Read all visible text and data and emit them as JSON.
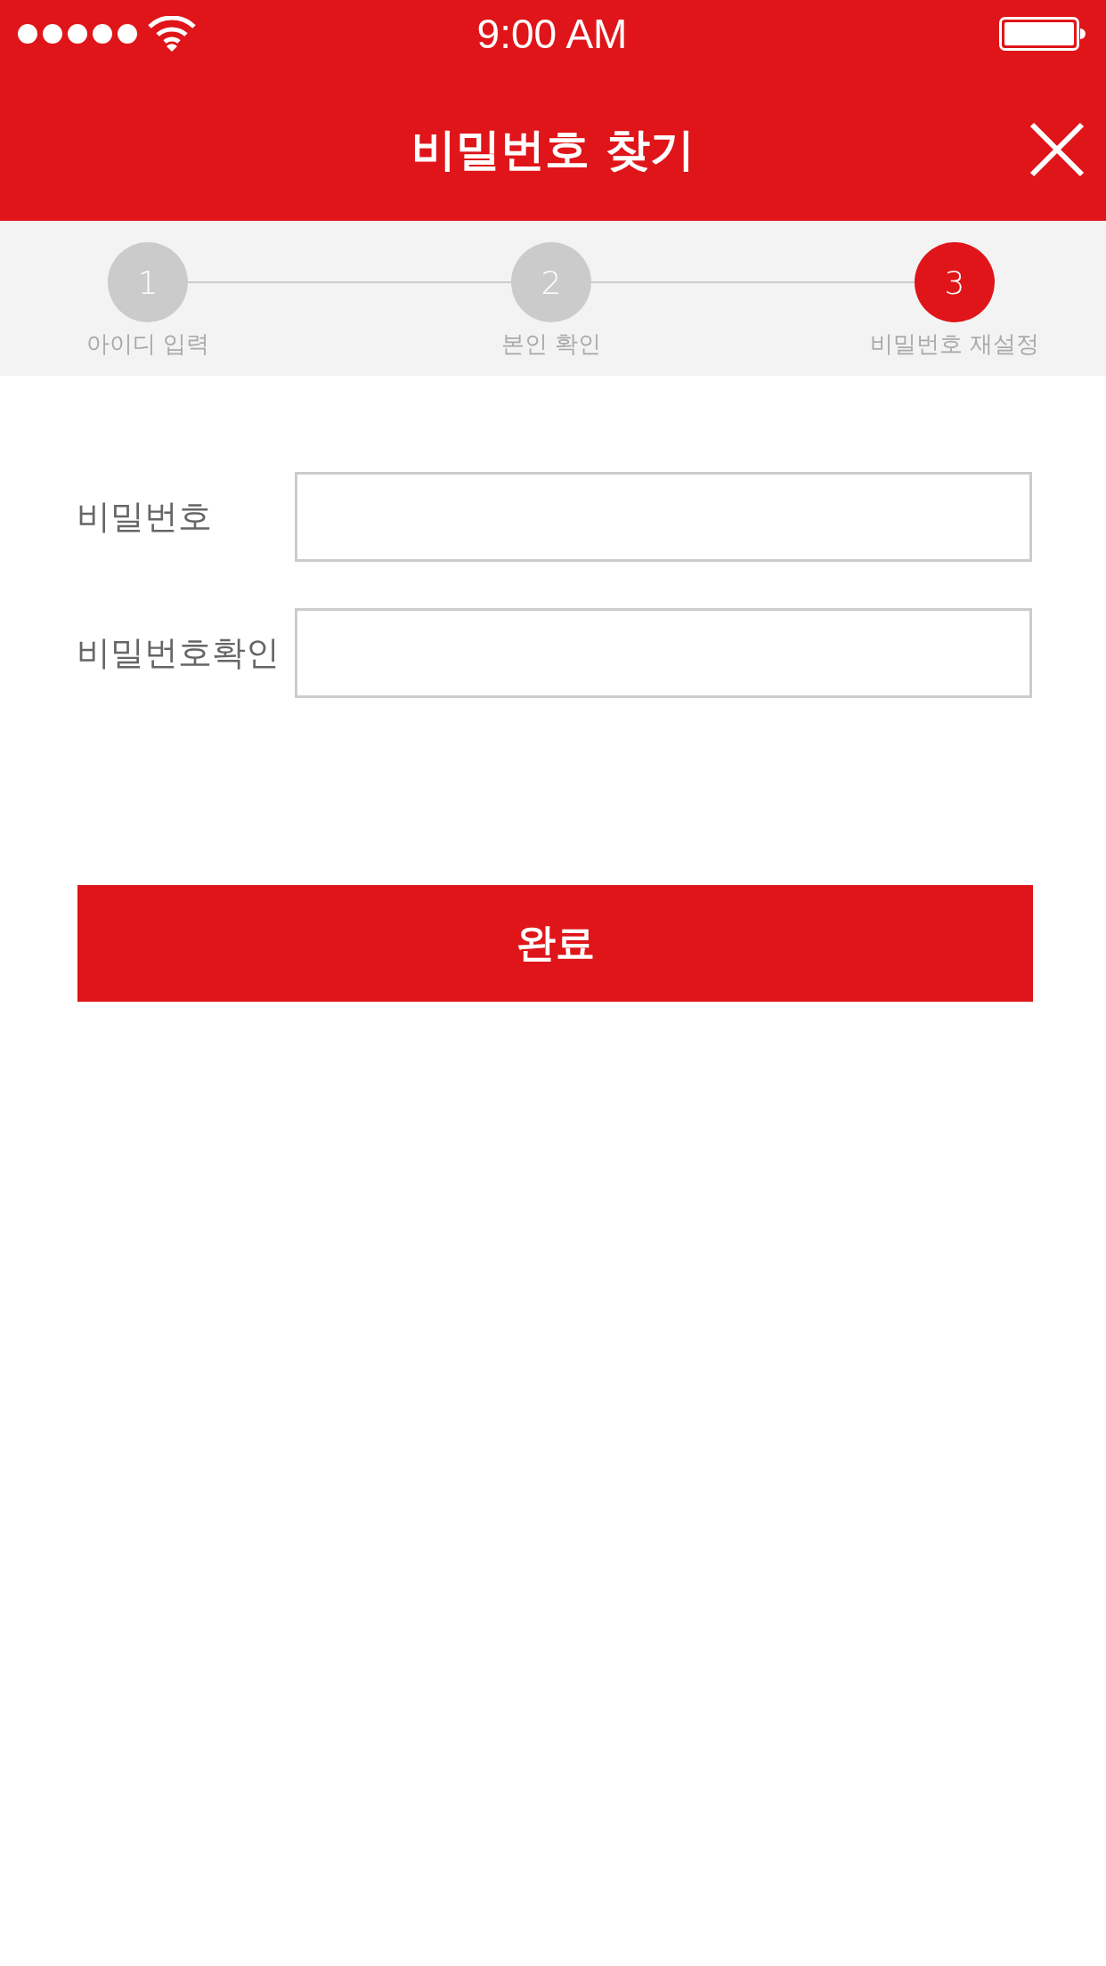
{
  "status_bar": {
    "time": "9:00 AM"
  },
  "header": {
    "title": "비밀번호 찾기"
  },
  "steps": [
    {
      "number": "1",
      "label": "아이디 입력",
      "selected": false
    },
    {
      "number": "2",
      "label": "본인 확인",
      "selected": false
    },
    {
      "number": "3",
      "label": "비밀번호 재설정",
      "selected": true
    }
  ],
  "form": {
    "fields": [
      {
        "label": "비밀번호"
      },
      {
        "label": "비밀번호확인"
      }
    ]
  },
  "submit_button": {
    "label": "완료"
  }
}
